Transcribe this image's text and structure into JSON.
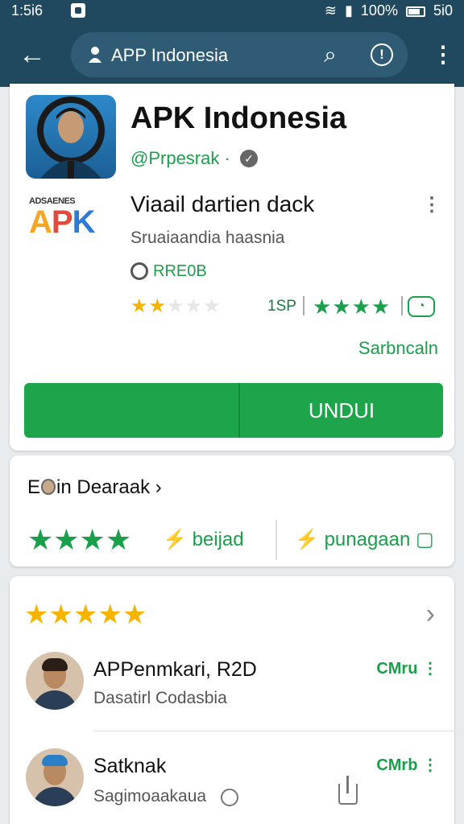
{
  "status_bar": {
    "time": "1:5i6",
    "right_text": "100%",
    "right_time": "5i0"
  },
  "appbar": {
    "search_title": "APP Indonesia"
  },
  "app": {
    "title": "APK Indonesia",
    "publisher": "@Prpesrak ·",
    "logo_small": "ADSAENES",
    "logo_big_a": "A",
    "logo_big_p": "P",
    "logo_big_k": "K",
    "subtitle": "Viaail dartien dack",
    "developer": "Sruaiaandia haasnia",
    "grade": "RRE0B",
    "rating_count": "1SP",
    "category": "Sarbncaln",
    "install_label": "UNDUI",
    "yellow_stars": 2.5,
    "green_stars": 4
  },
  "more_section": {
    "title_a": "E",
    "title_b": "in Dearaak ›",
    "tag1": "beijad",
    "tag2": "punagaan"
  },
  "reviews": [
    {
      "name": "APPenmkari, R2D",
      "sub": "Dasatirl Codasbia",
      "meta": "CMru ⋮"
    },
    {
      "name": "Satknak",
      "sub": "Sagimoaakaua",
      "meta": "CMrb ⋮"
    }
  ],
  "colors": {
    "appbar": "#20485f",
    "accent_green": "#1ea54c",
    "star_yellow": "#f4b400"
  }
}
